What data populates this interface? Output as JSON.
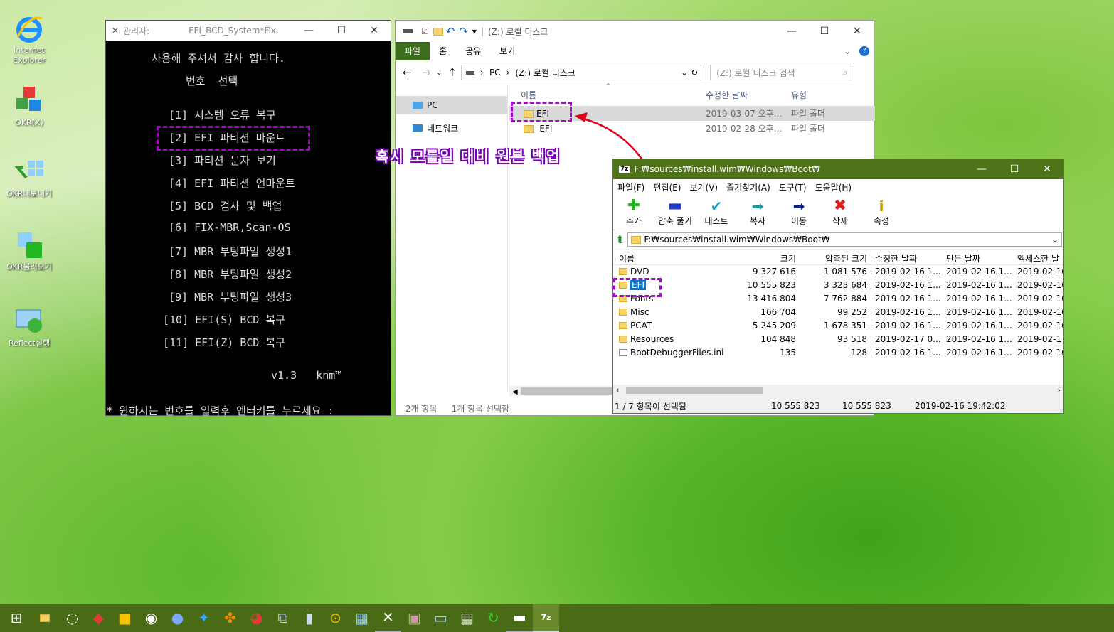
{
  "desktop": {
    "icons": [
      {
        "label": "Internet Explorer",
        "icon": "ie-icon"
      },
      {
        "label": "OKR(X)",
        "icon": "okr-icon"
      },
      {
        "label": "OKR내보내기",
        "icon": "export-icon"
      },
      {
        "label": "OKR불러오기",
        "icon": "import-icon"
      },
      {
        "label": "Reflect실행",
        "icon": "reflect-icon"
      }
    ]
  },
  "cmd": {
    "title_prefix": "관리자:",
    "title": "EFI_BCD_System*Fix.",
    "header1": "사용해 주셔서 감사 합니다.",
    "header2": "번호  선택",
    "menu": [
      "[1] 시스템 오류 복구",
      "[2] EFI 파티션 마운트",
      "[3] 파티션 문자 보기",
      "[4] EFI 파티션 언마운트",
      "[5] BCD 검사 및 백업",
      "[6] FIX-MBR,Scan-OS",
      "[7] MBR 부팅파일 생성1",
      "[8] MBR 부팅파일 생성2",
      "[9] MBR 부팅파일 생성3",
      "[10] EFI(S) BCD 복구",
      "[11] EFI(Z) BCD 복구"
    ],
    "version": "v1.3   knm™",
    "prompt": "* 원하시는 번호를 입력후 엔터키를 누르세요 :"
  },
  "explorer": {
    "title": "(Z:) 로컬 디스크",
    "tabs": [
      "파일",
      "홈",
      "공유",
      "보기"
    ],
    "crumbs": [
      "PC",
      "(Z:) 로컬 디스크"
    ],
    "search_placeholder": "(Z:) 로컬 디스크 검색",
    "nav": [
      "PC",
      "네트워크"
    ],
    "columns": [
      "이름",
      "수정한 날짜",
      "유형"
    ],
    "rows": [
      {
        "name": "EFI",
        "date": "2019-03-07 오후...",
        "type": "파일 폴더"
      },
      {
        "name": "-EFI",
        "date": "2019-02-28 오후...",
        "type": "파일 폴더"
      }
    ],
    "status_count": "2개 항목",
    "status_selected": "1개 항목 선택함"
  },
  "annotation": "혹시 모를일 대비 원본 백업",
  "sevenzip": {
    "title": "F:₩sources₩install.wim₩Windows₩Boot₩",
    "menu": [
      "파일(F)",
      "편집(E)",
      "보기(V)",
      "즐겨찾기(A)",
      "도구(T)",
      "도움말(H)"
    ],
    "tools": [
      "추가",
      "압축 풀기",
      "테스트",
      "복사",
      "이동",
      "삭제",
      "속성"
    ],
    "path": "F:₩sources₩install.wim₩Windows₩Boot₩",
    "columns": [
      "이름",
      "크기",
      "압축된 크기",
      "수정한 날짜",
      "만든 날짜",
      "액세스한 날"
    ],
    "rows": [
      {
        "name": "DVD",
        "size": "9 327 616",
        "packed": "1 081 576",
        "mod": "2019-02-16 1...",
        "created": "2019-02-16 1...",
        "access": "2019-02-16"
      },
      {
        "name": "EFI",
        "size": "10 555 823",
        "packed": "3 323 684",
        "mod": "2019-02-16 1...",
        "created": "2019-02-16 1...",
        "access": "2019-02-16"
      },
      {
        "name": "Fonts",
        "size": "13 416 804",
        "packed": "7 762 884",
        "mod": "2019-02-16 1...",
        "created": "2019-02-16 1...",
        "access": "2019-02-16"
      },
      {
        "name": "Misc",
        "size": "166 704",
        "packed": "99 252",
        "mod": "2019-02-16 1...",
        "created": "2019-02-16 1...",
        "access": "2019-02-16"
      },
      {
        "name": "PCAT",
        "size": "5 245 209",
        "packed": "1 678 351",
        "mod": "2019-02-16 1...",
        "created": "2019-02-16 1...",
        "access": "2019-02-16"
      },
      {
        "name": "Resources",
        "size": "104 848",
        "packed": "93 518",
        "mod": "2019-02-17 0...",
        "created": "2019-02-16 1...",
        "access": "2019-02-17"
      },
      {
        "name": "BootDebuggerFiles.ini",
        "size": "135",
        "packed": "128",
        "mod": "2019-02-16 1...",
        "created": "2019-02-16 1...",
        "access": "2019-02-16"
      }
    ],
    "status": [
      "1 / 7 항목이 선택됨",
      "10 555 823",
      "10 555 823",
      "2019-02-16 19:42:02"
    ]
  },
  "colors": {
    "accent": "#b100d6",
    "titlebar_7z": "#4e7318",
    "ribbon_file": "#3c6e1e"
  }
}
